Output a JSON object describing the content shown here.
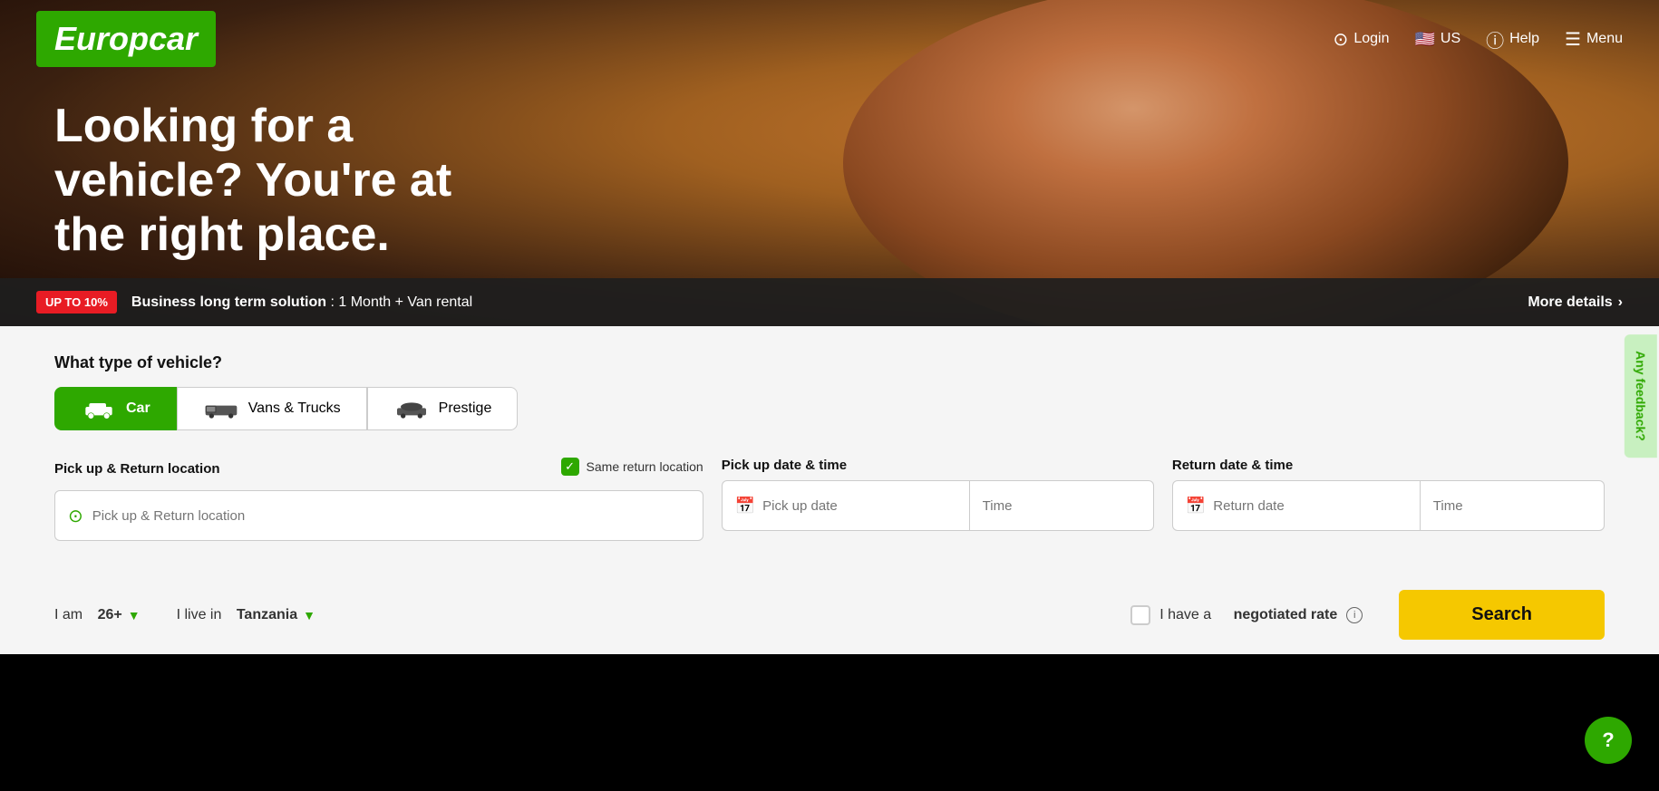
{
  "brand": {
    "name": "Europcar",
    "logo_color": "#2ea800"
  },
  "navbar": {
    "login_label": "Login",
    "country_label": "US",
    "help_label": "Help",
    "menu_label": "Menu"
  },
  "hero": {
    "headline": "Looking for a vehicle? You're at the right place.",
    "bg_overlay": "rgba(0,0,0,0.5)"
  },
  "promo": {
    "badge": "UP TO 10%",
    "text_bold": "Business long term solution",
    "text_detail": " : 1 Month + Van rental",
    "more_label": "More details"
  },
  "booking": {
    "vehicle_question": "What type of vehicle?",
    "tabs": [
      {
        "id": "car",
        "label": "Car",
        "active": true
      },
      {
        "id": "vans",
        "label": "Vans & Trucks",
        "active": false
      },
      {
        "id": "prestige",
        "label": "Prestige",
        "active": false
      }
    ],
    "pickup_location_label": "Pick up & Return location",
    "same_return_label": "Same return location",
    "pickup_location_placeholder": "Pick up & Return location",
    "pickup_date_label": "Pick up date & time",
    "pickup_date_placeholder": "Pick up date",
    "pickup_time_placeholder": "Time",
    "return_date_label": "Return date & time",
    "return_date_placeholder": "Return date",
    "return_time_placeholder": "Time"
  },
  "bottom": {
    "age_prefix": "I am",
    "age_value": "26+",
    "country_prefix": "I live in",
    "country_value": "Tanzania",
    "negotiated_label": "I have a",
    "negotiated_bold": "negotiated rate",
    "search_label": "Search"
  },
  "feedback": {
    "label": "Any feedback?"
  },
  "help_bubble": {
    "symbol": "?"
  }
}
